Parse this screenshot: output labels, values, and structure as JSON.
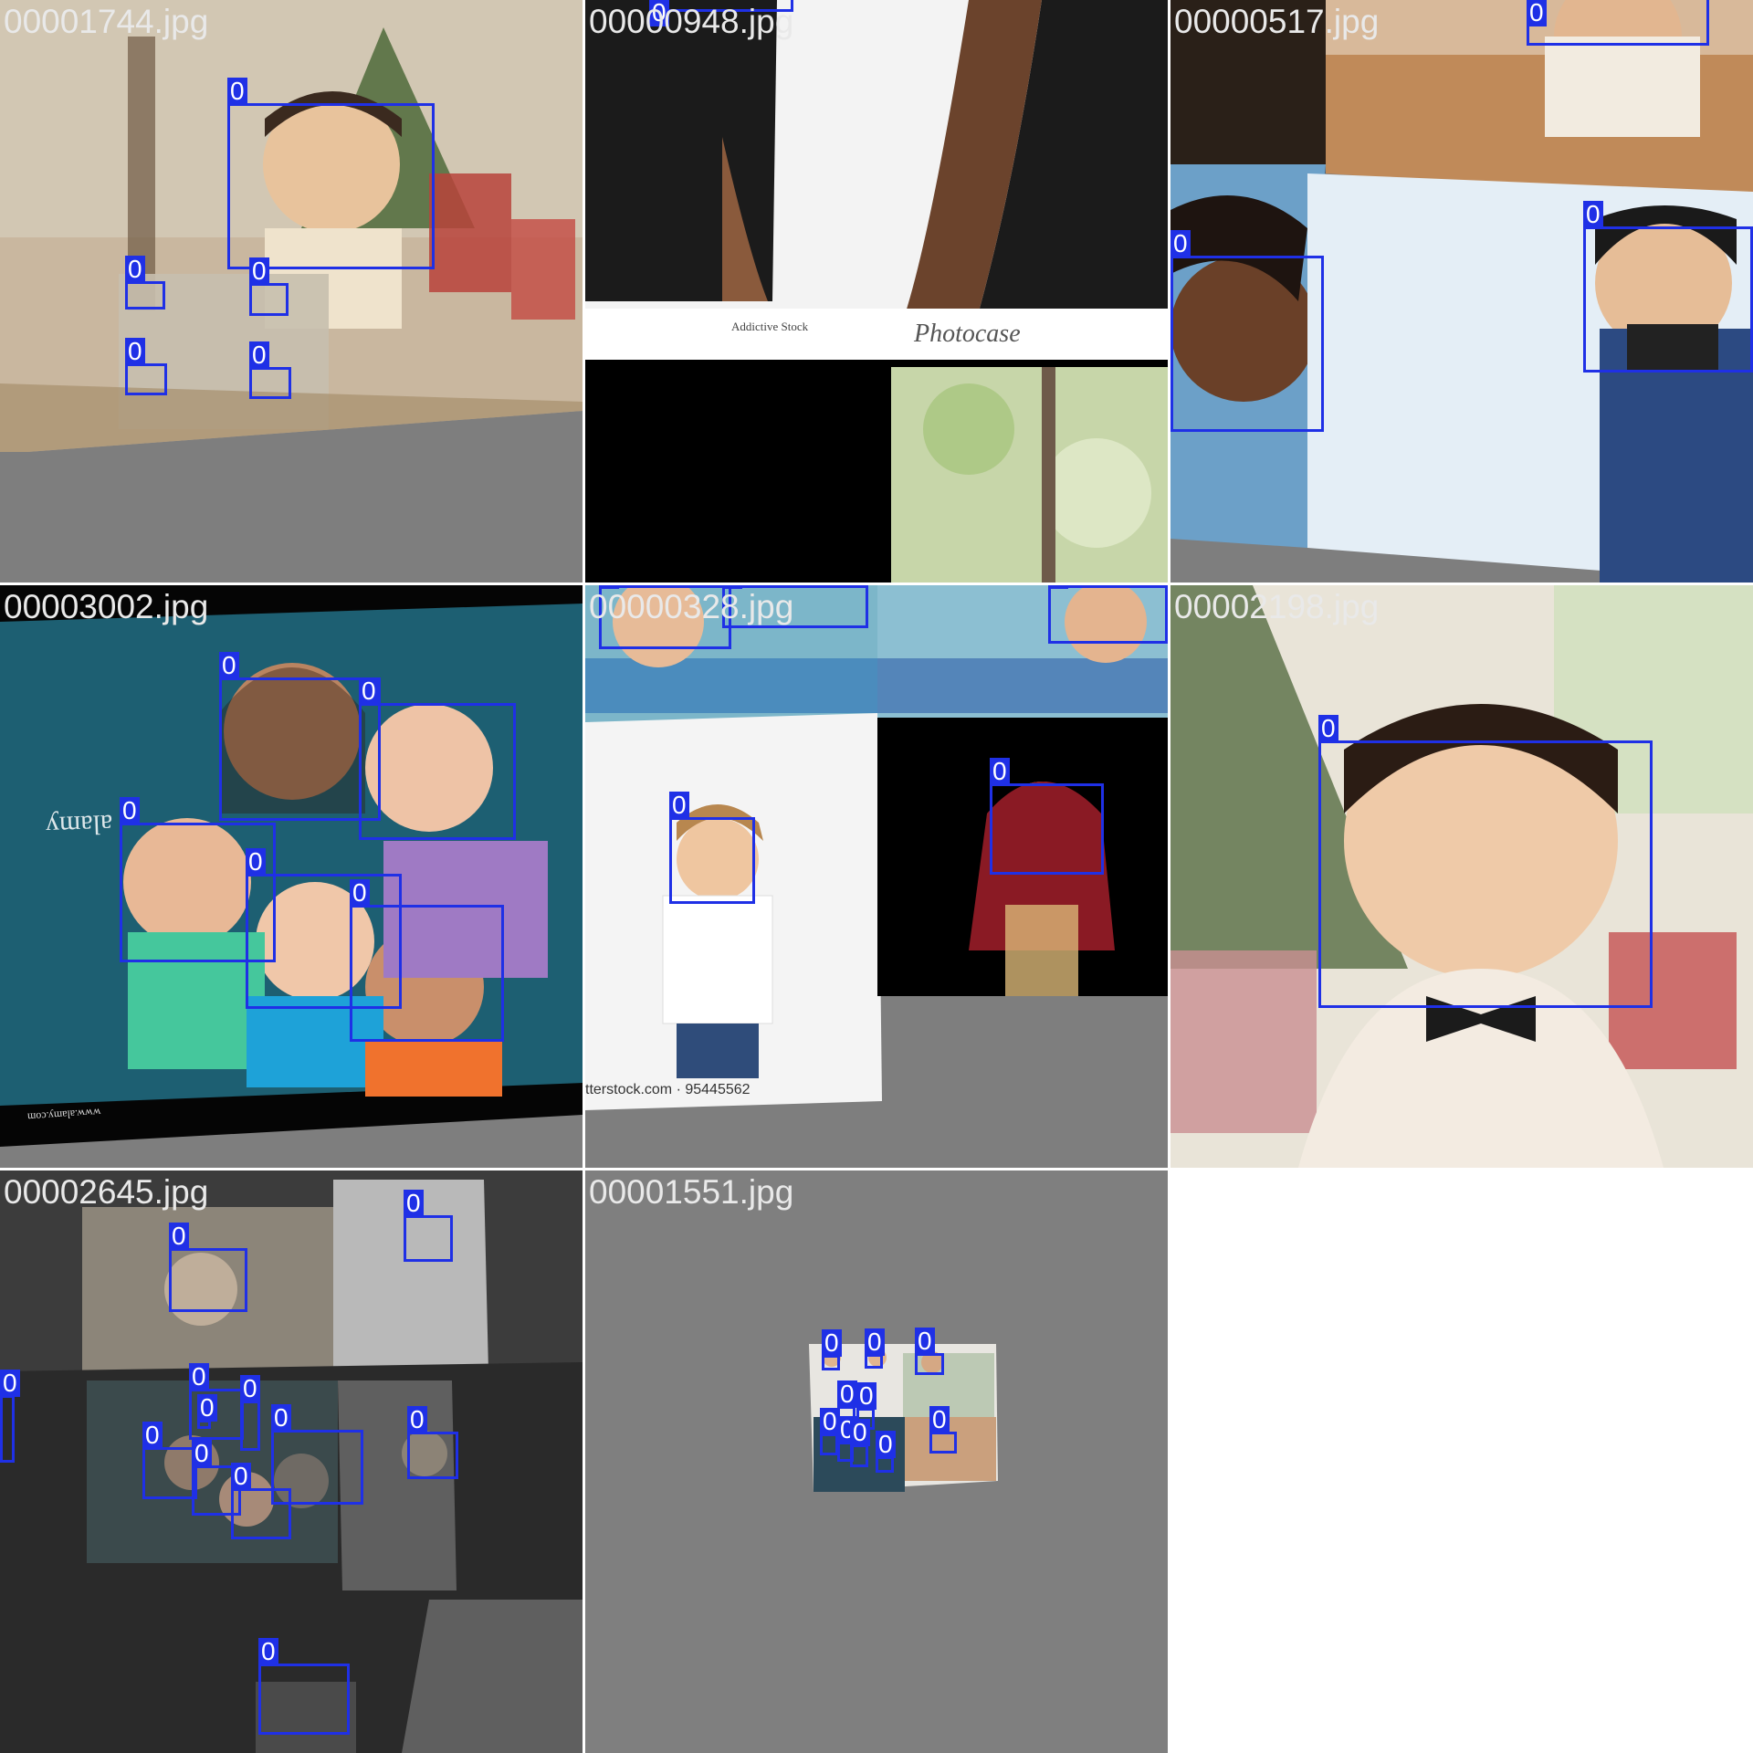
{
  "label_color": "#1f30e6",
  "tiles": [
    {
      "file": "00001744.jpg",
      "boxes": [
        "0",
        "0",
        "0",
        "0",
        "0"
      ]
    },
    {
      "file": "00000948.jpg",
      "boxes": [
        "0"
      ],
      "watermarks": [
        "Addictive Stock",
        "Photocase"
      ]
    },
    {
      "file": "00000517.jpg",
      "boxes": [
        "0",
        "0",
        "0"
      ]
    },
    {
      "file": "00003002.jpg",
      "boxes": [
        "0",
        "0",
        "0",
        "0",
        "0"
      ],
      "watermarks": [
        "alamy",
        "www.alamy.com"
      ]
    },
    {
      "file": "00000328.jpg",
      "boxes": [
        "0",
        "0",
        "0",
        "0",
        "0"
      ],
      "watermarks": [
        "tterstock.com · 95445562"
      ]
    },
    {
      "file": "00002198.jpg",
      "boxes": [
        "0"
      ]
    },
    {
      "file": "00002645.jpg",
      "boxes": [
        "0",
        "0",
        "0",
        "0",
        "0",
        "0",
        "0",
        "0",
        "0",
        "0",
        "0",
        "0"
      ]
    },
    {
      "file": "00001551.jpg",
      "boxes": [
        "0",
        "0",
        "0",
        "0",
        "0",
        "0",
        "0",
        "0",
        "0",
        "0"
      ]
    }
  ]
}
